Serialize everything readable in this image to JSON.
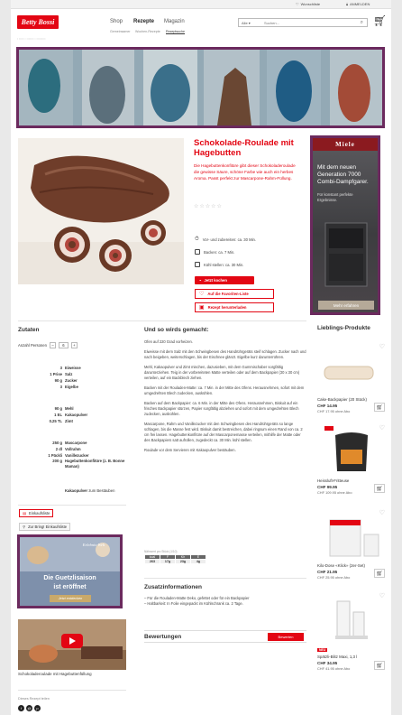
{
  "topbar": {
    "wishlist": "Wunschliste",
    "login": "ANMELDEN"
  },
  "brand": {
    "logo": "Betty Bossi",
    "accent": "#e30613",
    "ad_border": "#6b2a5e"
  },
  "nav": {
    "items": [
      "Shop",
      "Rezepte",
      "Magazin"
    ],
    "active": "Rezepte"
  },
  "subnav": {
    "items": [
      "Gemeinsamer",
      "Wochen-Rezepte",
      "Rezeptsuche"
    ]
  },
  "search": {
    "scope": "Alle ▾",
    "placeholder": "Suchen..."
  },
  "recipe": {
    "title": "Schokolade-Roulade mit Hagebutten",
    "description": "Die Hagebuttenkonfitüre gibt dieser Schokoladeroulade die gewisse Säure, schöne Farbe wie auch ein herbes Aroma. Passt perfekt zur Mascarpone-Rahm-Füllung.",
    "stars": "☆☆☆☆☆",
    "times": [
      "Vor- und zubereiten: ca. 30 Min.",
      "Backen: ca. 7 Min.",
      "Kühl stellen: ca. 30 Min."
    ],
    "cook_button": "Jetzt kochen",
    "fav_button": "Auf die Favoriten-Liste",
    "download_button": "Rezept herunterladen"
  },
  "ad_side": {
    "brand": "Miele",
    "headline": "Mit dem neuen Generation 7000 Combi-Dampfgarer.",
    "sub": "Für konstant perfekte Ergebnisse.",
    "cta": "Mehr erfahren"
  },
  "ingredients": {
    "heading": "Zutaten",
    "persons_label": "Anzahl Personen",
    "persons_value": "6",
    "groups": [
      [
        {
          "amt": "3",
          "name": "Eiweisse"
        },
        {
          "amt": "1 Prise",
          "name": "Salz"
        },
        {
          "amt": "90 g",
          "name": "Zucker"
        },
        {
          "amt": "3",
          "name": "Eigelbe"
        }
      ],
      [
        {
          "amt": "90 g",
          "name": "Mehl"
        },
        {
          "amt": "1 EL",
          "name": "Kakaopulver"
        },
        {
          "amt": "0.25 TL",
          "name": "Zimt"
        }
      ],
      [
        {
          "amt": "250 g",
          "name": "Mascarpone"
        },
        {
          "amt": "2 dl",
          "name": "Vollrahm"
        },
        {
          "amt": "1 Päckli",
          "name": "Vanillezucker"
        },
        {
          "amt": "200 g",
          "name": "Hagebuttenkonfitüre (z. B. Bonne Maman)"
        }
      ]
    ],
    "dust": "Kakaopulver",
    "dust_suffix": "zum Bestäuben"
  },
  "lists": {
    "shopping": "Einkaufsliste",
    "bring": "Zur Bring! Einkaufsliste"
  },
  "ad_small": {
    "line1": "Erlebnis-Welt",
    "line2": "Die Guetzlisaison",
    "line3": "ist eröffnet",
    "cta": "Jetzt entdecken"
  },
  "video": {
    "caption": "Schokoladeroulade mit Hagebuttenfüllung"
  },
  "share": {
    "label": "Dieses Rezept teilen"
  },
  "steps": {
    "heading": "Und so wirds gemacht:",
    "items": [
      "Ofen auf 220 Grad vorheizen.",
      "Eiweisse mit dem Salz mit den Schwingbesen des Handrührgeräts steif schlagen. Zucker nach und nach beigeben, weiterschlagen, bis der Eischnee glänzt. Eigelbe kurz darunterrühren.",
      "Mehl, Kakaopulver und Zimt mischen, dazusieben, mit dem Gummischaber sorgfältig darunterziehen. Teig in der vorbereiteten Matte verteilen oder auf dem Backpapier (30 x 30 cm) verteilen, auf ein Backblech ziehen.",
      "Backen mit der Rouladen-Matte: ca. 7 Min. in der Mitte des Ofens. Herausnehmen, sofort mit dem umgedrehten Blech zudecken, auskühlen.",
      "Backen auf dem Backpapier: ca. 6 Min. in der Mitte des Ofens. Herausnehmen, Biskuit auf ein frisches Backpapier stürzen, Papier sorgfältig abziehen und sofort mit dem umgedrehten Blech zudecken, auskühlen.",
      "Mascarpone, Rahm und Vanillezucker mit den Schwingbesen des Handrührgeräts so lange schlagen, bis die Masse fest wird. Biskuit damit bestreichen, dabei ringsum einen Rand von ca. 2 cm frei lassen. Hagebuttenkonfitüre auf der Mascarponemasse verteilen, mithilfe der Matte oder des Backpapiers satt aufrollen, zugedeckt ca. 30 Min. kühl stellen.",
      "Roulade vor dem Servieren mit Kakaopulver bestäuben."
    ]
  },
  "nutrition": {
    "caption": "Nährwert pro Stück (1/10)",
    "headers": [
      "kcal",
      "F",
      "Kh",
      "E"
    ],
    "values": [
      "263",
      "17g",
      "23g",
      "4g"
    ]
  },
  "zusatz": {
    "heading": "Zusatzinformationen",
    "items": [
      "– Für die Rouladen-Matte Deko, gefettet oder für ein Backpapier",
      "– Haltbarkeit: In Folie eingepackt im Kühlschrank ca. 2 Tage."
    ]
  },
  "ratings": {
    "heading": "Bewertungen",
    "button": "Bewerten"
  },
  "favorites": {
    "heading": "Lieblings-Produkte",
    "products": [
      {
        "name": "Cake-Backpapier (20 Stück)",
        "price": "CHF 14.95",
        "abo": "CHF 17.95 ohne Abo",
        "badge": ""
      },
      {
        "name": "Heissluft-Fritteuse",
        "price": "CHF 99.95",
        "abo": "CHF 109.95 ohne Abo",
        "badge": ""
      },
      {
        "name": "Kilo-Dose «Klick» (2er-Set)",
        "price": "CHF 21.95",
        "abo": "CHF 25.95 ohne Abo",
        "badge": ""
      },
      {
        "name": "Spätzli-Blitz Maxi, 1,3 l",
        "price": "CHF 34.95",
        "abo": "CHF 41.95 ohne Abo",
        "badge": "NEU"
      }
    ]
  }
}
